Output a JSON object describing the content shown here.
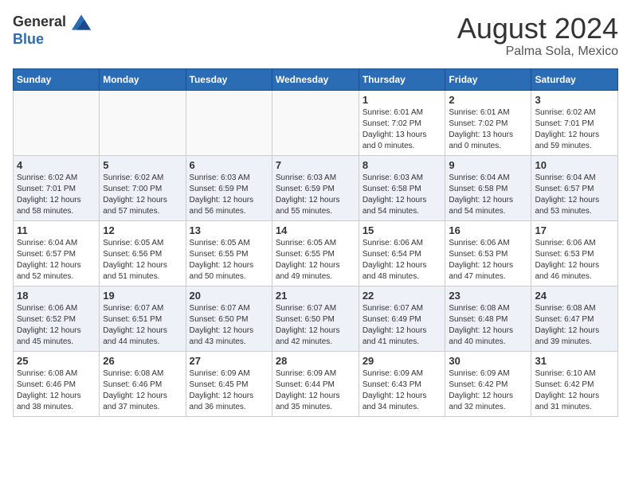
{
  "header": {
    "logo_general": "General",
    "logo_blue": "Blue",
    "month_title": "August 2024",
    "location": "Palma Sola, Mexico"
  },
  "days_of_week": [
    "Sunday",
    "Monday",
    "Tuesday",
    "Wednesday",
    "Thursday",
    "Friday",
    "Saturday"
  ],
  "weeks": [
    {
      "row_class": "row-norm",
      "days": [
        {
          "number": "",
          "info": "",
          "empty": true
        },
        {
          "number": "",
          "info": "",
          "empty": true
        },
        {
          "number": "",
          "info": "",
          "empty": true
        },
        {
          "number": "",
          "info": "",
          "empty": true
        },
        {
          "number": "1",
          "info": "Sunrise: 6:01 AM\nSunset: 7:02 PM\nDaylight: 13 hours and 0 minutes.",
          "empty": false
        },
        {
          "number": "2",
          "info": "Sunrise: 6:01 AM\nSunset: 7:02 PM\nDaylight: 13 hours and 0 minutes.",
          "empty": false
        },
        {
          "number": "3",
          "info": "Sunrise: 6:02 AM\nSunset: 7:01 PM\nDaylight: 12 hours and 59 minutes.",
          "empty": false
        }
      ]
    },
    {
      "row_class": "row-alt",
      "days": [
        {
          "number": "4",
          "info": "Sunrise: 6:02 AM\nSunset: 7:01 PM\nDaylight: 12 hours and 58 minutes.",
          "empty": false
        },
        {
          "number": "5",
          "info": "Sunrise: 6:02 AM\nSunset: 7:00 PM\nDaylight: 12 hours and 57 minutes.",
          "empty": false
        },
        {
          "number": "6",
          "info": "Sunrise: 6:03 AM\nSunset: 6:59 PM\nDaylight: 12 hours and 56 minutes.",
          "empty": false
        },
        {
          "number": "7",
          "info": "Sunrise: 6:03 AM\nSunset: 6:59 PM\nDaylight: 12 hours and 55 minutes.",
          "empty": false
        },
        {
          "number": "8",
          "info": "Sunrise: 6:03 AM\nSunset: 6:58 PM\nDaylight: 12 hours and 54 minutes.",
          "empty": false
        },
        {
          "number": "9",
          "info": "Sunrise: 6:04 AM\nSunset: 6:58 PM\nDaylight: 12 hours and 54 minutes.",
          "empty": false
        },
        {
          "number": "10",
          "info": "Sunrise: 6:04 AM\nSunset: 6:57 PM\nDaylight: 12 hours and 53 minutes.",
          "empty": false
        }
      ]
    },
    {
      "row_class": "row-norm",
      "days": [
        {
          "number": "11",
          "info": "Sunrise: 6:04 AM\nSunset: 6:57 PM\nDaylight: 12 hours and 52 minutes.",
          "empty": false
        },
        {
          "number": "12",
          "info": "Sunrise: 6:05 AM\nSunset: 6:56 PM\nDaylight: 12 hours and 51 minutes.",
          "empty": false
        },
        {
          "number": "13",
          "info": "Sunrise: 6:05 AM\nSunset: 6:55 PM\nDaylight: 12 hours and 50 minutes.",
          "empty": false
        },
        {
          "number": "14",
          "info": "Sunrise: 6:05 AM\nSunset: 6:55 PM\nDaylight: 12 hours and 49 minutes.",
          "empty": false
        },
        {
          "number": "15",
          "info": "Sunrise: 6:06 AM\nSunset: 6:54 PM\nDaylight: 12 hours and 48 minutes.",
          "empty": false
        },
        {
          "number": "16",
          "info": "Sunrise: 6:06 AM\nSunset: 6:53 PM\nDaylight: 12 hours and 47 minutes.",
          "empty": false
        },
        {
          "number": "17",
          "info": "Sunrise: 6:06 AM\nSunset: 6:53 PM\nDaylight: 12 hours and 46 minutes.",
          "empty": false
        }
      ]
    },
    {
      "row_class": "row-alt",
      "days": [
        {
          "number": "18",
          "info": "Sunrise: 6:06 AM\nSunset: 6:52 PM\nDaylight: 12 hours and 45 minutes.",
          "empty": false
        },
        {
          "number": "19",
          "info": "Sunrise: 6:07 AM\nSunset: 6:51 PM\nDaylight: 12 hours and 44 minutes.",
          "empty": false
        },
        {
          "number": "20",
          "info": "Sunrise: 6:07 AM\nSunset: 6:50 PM\nDaylight: 12 hours and 43 minutes.",
          "empty": false
        },
        {
          "number": "21",
          "info": "Sunrise: 6:07 AM\nSunset: 6:50 PM\nDaylight: 12 hours and 42 minutes.",
          "empty": false
        },
        {
          "number": "22",
          "info": "Sunrise: 6:07 AM\nSunset: 6:49 PM\nDaylight: 12 hours and 41 minutes.",
          "empty": false
        },
        {
          "number": "23",
          "info": "Sunrise: 6:08 AM\nSunset: 6:48 PM\nDaylight: 12 hours and 40 minutes.",
          "empty": false
        },
        {
          "number": "24",
          "info": "Sunrise: 6:08 AM\nSunset: 6:47 PM\nDaylight: 12 hours and 39 minutes.",
          "empty": false
        }
      ]
    },
    {
      "row_class": "row-norm",
      "days": [
        {
          "number": "25",
          "info": "Sunrise: 6:08 AM\nSunset: 6:46 PM\nDaylight: 12 hours and 38 minutes.",
          "empty": false
        },
        {
          "number": "26",
          "info": "Sunrise: 6:08 AM\nSunset: 6:46 PM\nDaylight: 12 hours and 37 minutes.",
          "empty": false
        },
        {
          "number": "27",
          "info": "Sunrise: 6:09 AM\nSunset: 6:45 PM\nDaylight: 12 hours and 36 minutes.",
          "empty": false
        },
        {
          "number": "28",
          "info": "Sunrise: 6:09 AM\nSunset: 6:44 PM\nDaylight: 12 hours and 35 minutes.",
          "empty": false
        },
        {
          "number": "29",
          "info": "Sunrise: 6:09 AM\nSunset: 6:43 PM\nDaylight: 12 hours and 34 minutes.",
          "empty": false
        },
        {
          "number": "30",
          "info": "Sunrise: 6:09 AM\nSunset: 6:42 PM\nDaylight: 12 hours and 32 minutes.",
          "empty": false
        },
        {
          "number": "31",
          "info": "Sunrise: 6:10 AM\nSunset: 6:42 PM\nDaylight: 12 hours and 31 minutes.",
          "empty": false
        }
      ]
    }
  ]
}
